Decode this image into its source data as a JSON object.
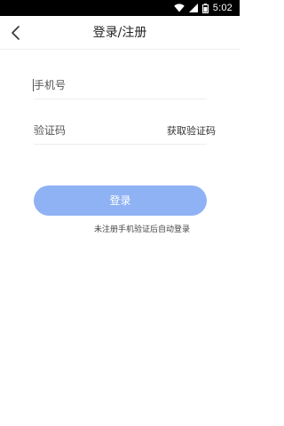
{
  "status_bar": {
    "time": "5:02",
    "icons": [
      "wifi-icon",
      "signal-icon",
      "battery-icon"
    ]
  },
  "header": {
    "title": "登录/注册",
    "back_icon": "chevron-left-icon"
  },
  "form": {
    "phone_placeholder": "手机号",
    "phone_value": "",
    "code_placeholder": "验证码",
    "code_value": "",
    "get_code_label": "获取验证码"
  },
  "login_button": {
    "label": "登录",
    "color": "#8fb2f5"
  },
  "hint_text": "未注册手机验证后自动登录"
}
